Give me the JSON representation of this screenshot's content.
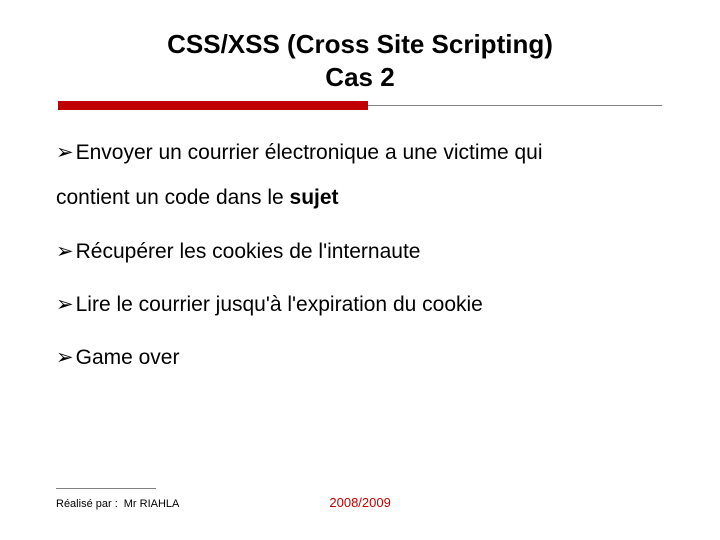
{
  "title_line1": "CSS/XSS (Cross Site Scripting)",
  "title_line2": "Cas 2",
  "bullets": {
    "b1_pre": "Envoyer un courrier électronique a une victime qui",
    "b1_cont_pre": "contient un code dans le ",
    "b1_cont_bold": "sujet",
    "b2": "Récupérer les cookies de l'internaute",
    "b3": "Lire le courrier jusqu'à l'expiration du cookie",
    "b4": "Game over"
  },
  "footer": {
    "label": "Réalisé par :",
    "author": "Mr RIAHLA",
    "year": "2008/2009"
  },
  "glyphs": {
    "arrow": "➢"
  }
}
